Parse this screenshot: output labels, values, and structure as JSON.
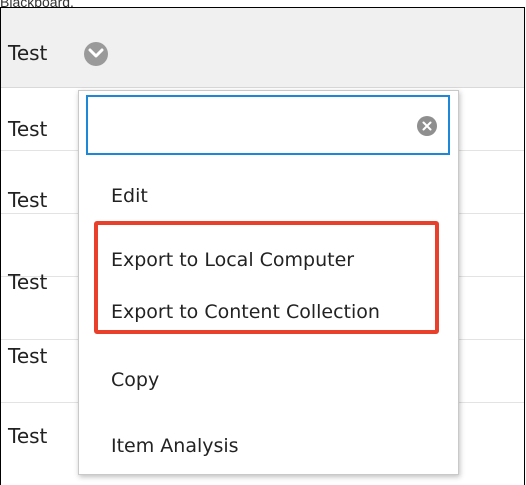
{
  "caption": "Blackboard.",
  "header": {
    "label": "Test"
  },
  "rows": [
    {
      "label": "Test"
    },
    {
      "label": "Test"
    },
    {
      "label": "Test"
    },
    {
      "label": "Test"
    },
    {
      "label": "Test"
    }
  ],
  "menu": {
    "search": {
      "value": "",
      "placeholder": ""
    },
    "items": [
      {
        "label": "Edit"
      },
      {
        "label": "Export to Local Computer"
      },
      {
        "label": "Export to Content Collection"
      },
      {
        "label": "Copy"
      },
      {
        "label": "Item Analysis"
      }
    ]
  },
  "colors": {
    "focus_border": "#1e88d8",
    "highlight_border": "#e8402a",
    "header_bg": "#f0f0f0"
  },
  "icons": {
    "header_toggle": "chevron-down-icon",
    "search_clear": "clear-icon"
  }
}
